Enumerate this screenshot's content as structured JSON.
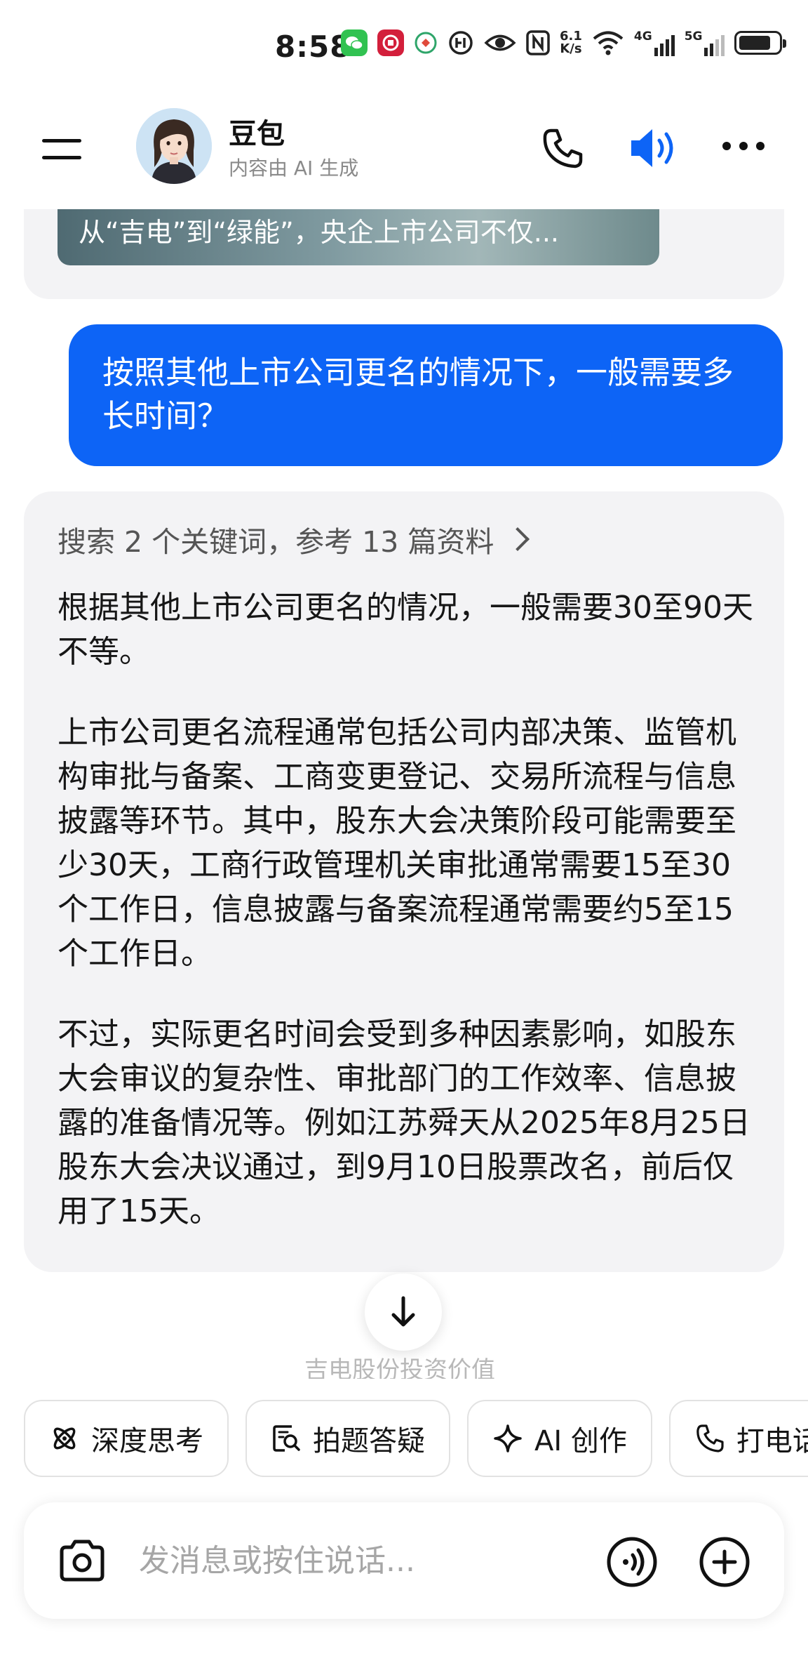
{
  "status_bar": {
    "time": "8:58",
    "net_rate_value": "6.1",
    "net_rate_unit": "K/s",
    "signal_1": "4G",
    "signal_2": "5G",
    "battery_level": 0.8,
    "icons": [
      "wechat-icon",
      "bank-app-icon",
      "app-icon",
      "hd-icon",
      "eye-icon",
      "nfc-icon",
      "wifi-icon",
      "signal-4g-icon",
      "signal-5g-icon",
      "battery-icon"
    ]
  },
  "header": {
    "bot_name": "豆包",
    "bot_subtitle": "内容由 AI 生成",
    "accent_color": "#0d64f6"
  },
  "conversation": {
    "previous_card_title": "从“吉电”到“绿能”，央企上市公司不仅...",
    "user_message": "按照其他上市公司更名的情况下，一般需要多长时间？",
    "search_summary": "搜索 2 个关键词，参考 13 篇资料",
    "answer_paragraphs": [
      "根据其他上市公司更名的情况，一般需要30至90天不等。",
      "上市公司更名流程通常包括公司内部决策、监管机构审批与备案、工商变更登记、交易所流程与信息披露等环节。其中，股东大会决策阶段可能需要至少30天，工商行政管理机关审批通常需要15至30个工作日，信息披露与备案流程通常需要约5至15个工作日。",
      "不过，实际更名时间会受到多种因素影响，如股东大会审议的复杂性、审批部门的工作效率、信息披露的准备情况等。例如江苏舜天从2025年8月25日股东大会决议通过，到9月10日股票改名，前后仅用了15天。"
    ],
    "suggestion_faded": "吉电股份投资价值"
  },
  "chips": [
    {
      "label": "深度思考",
      "icon": "atom-icon"
    },
    {
      "label": "拍题答疑",
      "icon": "photo-question-icon"
    },
    {
      "label": "AI 创作",
      "icon": "sparkle-icon"
    },
    {
      "label": "打电话",
      "icon": "phone-icon"
    }
  ],
  "input": {
    "placeholder": "发消息或按住说话..."
  }
}
